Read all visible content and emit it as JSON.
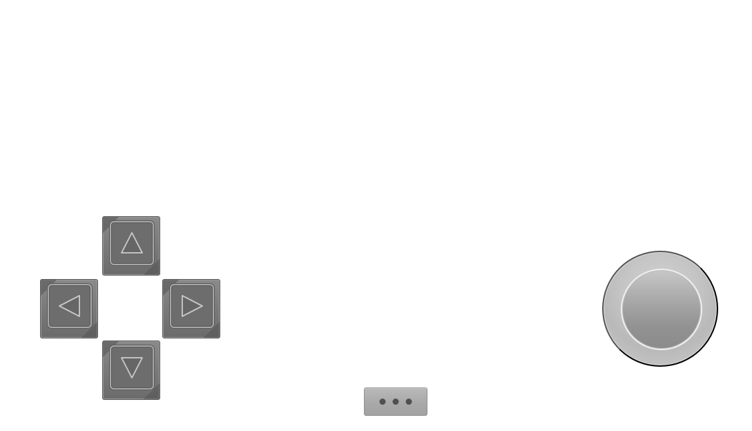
{
  "screen": {
    "background": "#ffffff"
  },
  "controls": {
    "dpad": {
      "up": "up-arrow-icon",
      "left": "left-arrow-icon",
      "right": "right-arrow-icon",
      "down": "down-arrow-icon"
    },
    "menu_button_icon": "more-dots-icon",
    "action_button_icon": "round-action-button"
  },
  "colors": {
    "key_face": "#6d6d6d",
    "key_border": "#a7a7a7",
    "menu_fill": "#a9a9a9",
    "action_outer": "#c4c4c4",
    "action_inner": "#929292"
  }
}
